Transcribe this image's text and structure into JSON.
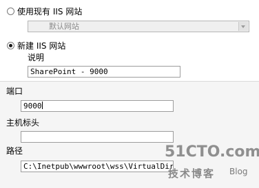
{
  "existing_site": {
    "radio_label": "使用现有 IIS 网站",
    "selected": false,
    "dropdown_value": "默认网站"
  },
  "new_site": {
    "radio_label": "新建 IIS 网站",
    "selected": true,
    "description_label": "说明",
    "description_value": "SharePoint - 9000"
  },
  "port": {
    "label": "端口",
    "value": "9000"
  },
  "host_header": {
    "label": "主机标头",
    "value": ""
  },
  "path": {
    "label": "路径",
    "value": "C:\\Inetpub\\wwwroot\\wss\\VirtualDirec"
  },
  "watermark": {
    "logo": "51CTO.com",
    "subtitle": "技术博客",
    "blog": "Blog"
  }
}
